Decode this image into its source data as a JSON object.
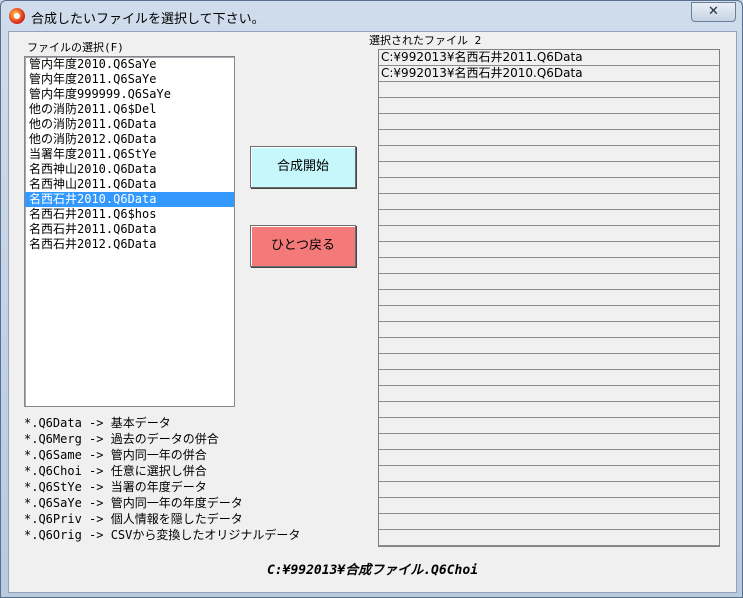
{
  "window": {
    "title": "合成したいファイルを選択して下さい。",
    "close_glyph": "✕"
  },
  "file_list": {
    "label": "ファイルの選択(F)",
    "items": [
      "管内年度2010.Q6SaYe",
      "管内年度2011.Q6SaYe",
      "管内年度999999.Q6SaYe",
      "他の消防2011.Q6$Del",
      "他の消防2011.Q6Data",
      "他の消防2012.Q6Data",
      "当署年度2011.Q6StYe",
      "名西神山2010.Q6Data",
      "名西神山2011.Q6Data",
      "名西石井2010.Q6Data",
      "名西石井2011.Q6$hos",
      "名西石井2011.Q6Data",
      "名西石井2012.Q6Data"
    ],
    "selected_item": "名西石井2010.Q6Data"
  },
  "buttons": {
    "start_label": "合成開始",
    "back_label": "ひとつ戻る"
  },
  "selected_files": {
    "label": "選択されたファイル 2",
    "items": [
      "C:¥992013¥名西石井2011.Q6Data",
      "C:¥992013¥名西石井2010.Q6Data"
    ]
  },
  "legend": [
    "*.Q6Data -> 基本データ",
    "*.Q6Merg -> 過去のデータの併合",
    "*.Q6Same -> 管内同一年の併合",
    "*.Q6Choi -> 任意に選択し併合",
    "*.Q6StYe -> 当署の年度データ",
    "*.Q6SaYe -> 管内同一年の年度データ",
    "*.Q6Priv -> 個人情報を隠したデータ",
    "*.Q6Orig -> CSVから変換したオリジナルデータ"
  ],
  "output_file": "C:¥992013¥合成ファイル.Q6Choi",
  "colors": {
    "start_button": "#c5f7fb",
    "back_button": "#f47a7a",
    "selection": "#3399ff"
  }
}
